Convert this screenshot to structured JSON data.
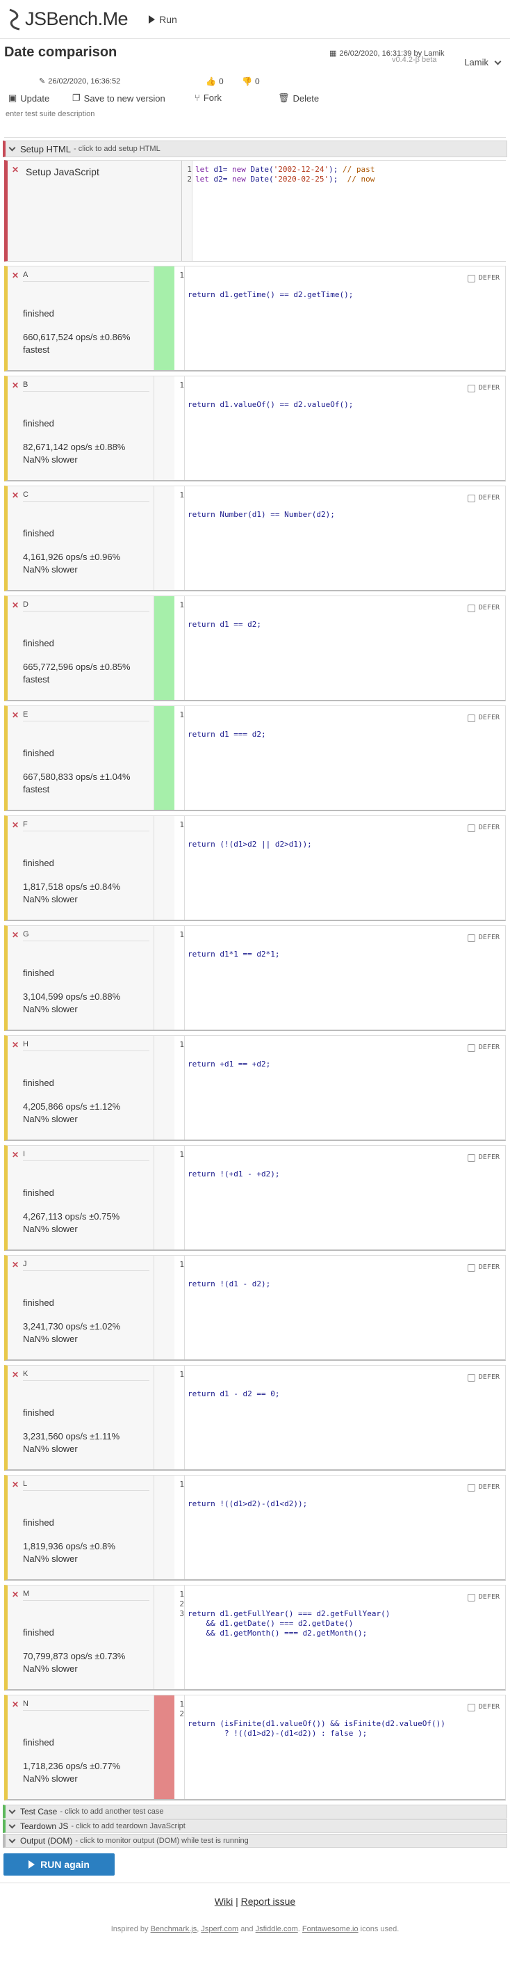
{
  "app": {
    "name": "JSBench.Me",
    "run_label": "Run"
  },
  "page": {
    "title": "Date comparison",
    "toolbar": {
      "update": "Update",
      "save_new": "Save to new version",
      "fork": "Fork",
      "delete": "Delete"
    },
    "meta": {
      "created": "26/02/2020, 16:31:39 by Lamik",
      "version": "v0.4.2-β beta",
      "user": "Lamik",
      "edited": "26/02/2020, 16:36:52",
      "likes": "0",
      "dislikes": "0"
    },
    "description_placeholder": "enter test suite description"
  },
  "sections": {
    "setup_html": {
      "label": "Setup HTML",
      "hint": "- click to add setup HTML"
    },
    "setup_js": {
      "label": "Setup JavaScript",
      "lines": [
        "1",
        "2"
      ]
    },
    "test_case": {
      "label": "Test Case",
      "hint": "- click to add another test case"
    },
    "teardown": {
      "label": "Teardown JS",
      "hint": "- click to add teardown JavaScript"
    },
    "output": {
      "label": "Output (DOM)",
      "hint": "- click to monitor output (DOM) while test is running"
    }
  },
  "defer_label": "DEFER",
  "tests": [
    {
      "name": "A",
      "status": "finished",
      "ops": "660,617,524 ops/s ±0.86%",
      "rank": "fastest",
      "result": "fastest",
      "code": [
        "return d1.getTime() == d2.getTime();"
      ]
    },
    {
      "name": "B",
      "status": "finished",
      "ops": "82,671,142 ops/s ±0.88%",
      "rank": "NaN% slower",
      "result": "normal",
      "code": [
        "return d1.valueOf() == d2.valueOf();"
      ]
    },
    {
      "name": "C",
      "status": "finished",
      "ops": "4,161,926 ops/s ±0.96%",
      "rank": "NaN% slower",
      "result": "normal",
      "code": [
        "return Number(d1) == Number(d2);"
      ]
    },
    {
      "name": "D",
      "status": "finished",
      "ops": "665,772,596 ops/s ±0.85%",
      "rank": "fastest",
      "result": "fastest",
      "code": [
        "return d1 == d2;"
      ]
    },
    {
      "name": "E",
      "status": "finished",
      "ops": "667,580,833 ops/s ±1.04%",
      "rank": "fastest",
      "result": "fastest",
      "code": [
        "return d1 === d2;"
      ]
    },
    {
      "name": "F",
      "status": "finished",
      "ops": "1,817,518 ops/s ±0.84%",
      "rank": "NaN% slower",
      "result": "normal",
      "code": [
        "return (!(d1>d2 || d2>d1));"
      ]
    },
    {
      "name": "G",
      "status": "finished",
      "ops": "3,104,599 ops/s ±0.88%",
      "rank": "NaN% slower",
      "result": "normal",
      "code": [
        "return d1*1 == d2*1;"
      ]
    },
    {
      "name": "H",
      "status": "finished",
      "ops": "4,205,866 ops/s ±1.12%",
      "rank": "NaN% slower",
      "result": "normal",
      "code": [
        "return +d1 == +d2;"
      ]
    },
    {
      "name": "I",
      "status": "finished",
      "ops": "4,267,113 ops/s ±0.75%",
      "rank": "NaN% slower",
      "result": "normal",
      "code": [
        "return !(+d1 - +d2);"
      ]
    },
    {
      "name": "J",
      "status": "finished",
      "ops": "3,241,730 ops/s ±1.02%",
      "rank": "NaN% slower",
      "result": "normal",
      "code": [
        "return !(d1 - d2);"
      ]
    },
    {
      "name": "K",
      "status": "finished",
      "ops": "3,231,560 ops/s ±1.11%",
      "rank": "NaN% slower",
      "result": "normal",
      "code": [
        "return d1 - d2 == 0;"
      ]
    },
    {
      "name": "L",
      "status": "finished",
      "ops": "1,819,936 ops/s ±0.8%",
      "rank": "NaN% slower",
      "result": "normal",
      "code": [
        "return !((d1>d2)-(d1<d2));"
      ]
    },
    {
      "name": "M",
      "status": "finished",
      "ops": "70,799,873 ops/s ±0.73%",
      "rank": "NaN% slower",
      "result": "normal",
      "code": [
        "return d1.getFullYear() === d2.getFullYear()",
        "    && d1.getDate() === d2.getDate()",
        "    && d1.getMonth() === d2.getMonth();"
      ]
    },
    {
      "name": "N",
      "status": "finished",
      "ops": "1,718,236 ops/s ±0.77%",
      "rank": "NaN% slower",
      "result": "slowest",
      "code": [
        "return (isFinite(d1.valueOf()) && isFinite(d2.valueOf())",
        "        ? !((d1>d2)-(d1<d2)) : false );"
      ]
    }
  ],
  "run_again_label": "RUN again",
  "footer": {
    "wiki": "Wiki",
    "sep": "|",
    "report": "Report issue",
    "inspired_prefix": "Inspired by",
    "benchmark": "Benchmark.js",
    "jsperf": "Jsperf.com",
    "and": "and",
    "jsfiddle": "Jsfiddle.com",
    "fontawesome": "Fontawesome.io",
    "icons_suffix": "icons used."
  },
  "colors": {
    "setup_accent": "#c64a57",
    "case_accent": "#e8c84a",
    "fastest": "#a6efaa",
    "slowest": "#e38787",
    "run_button": "#2b7fc1"
  }
}
